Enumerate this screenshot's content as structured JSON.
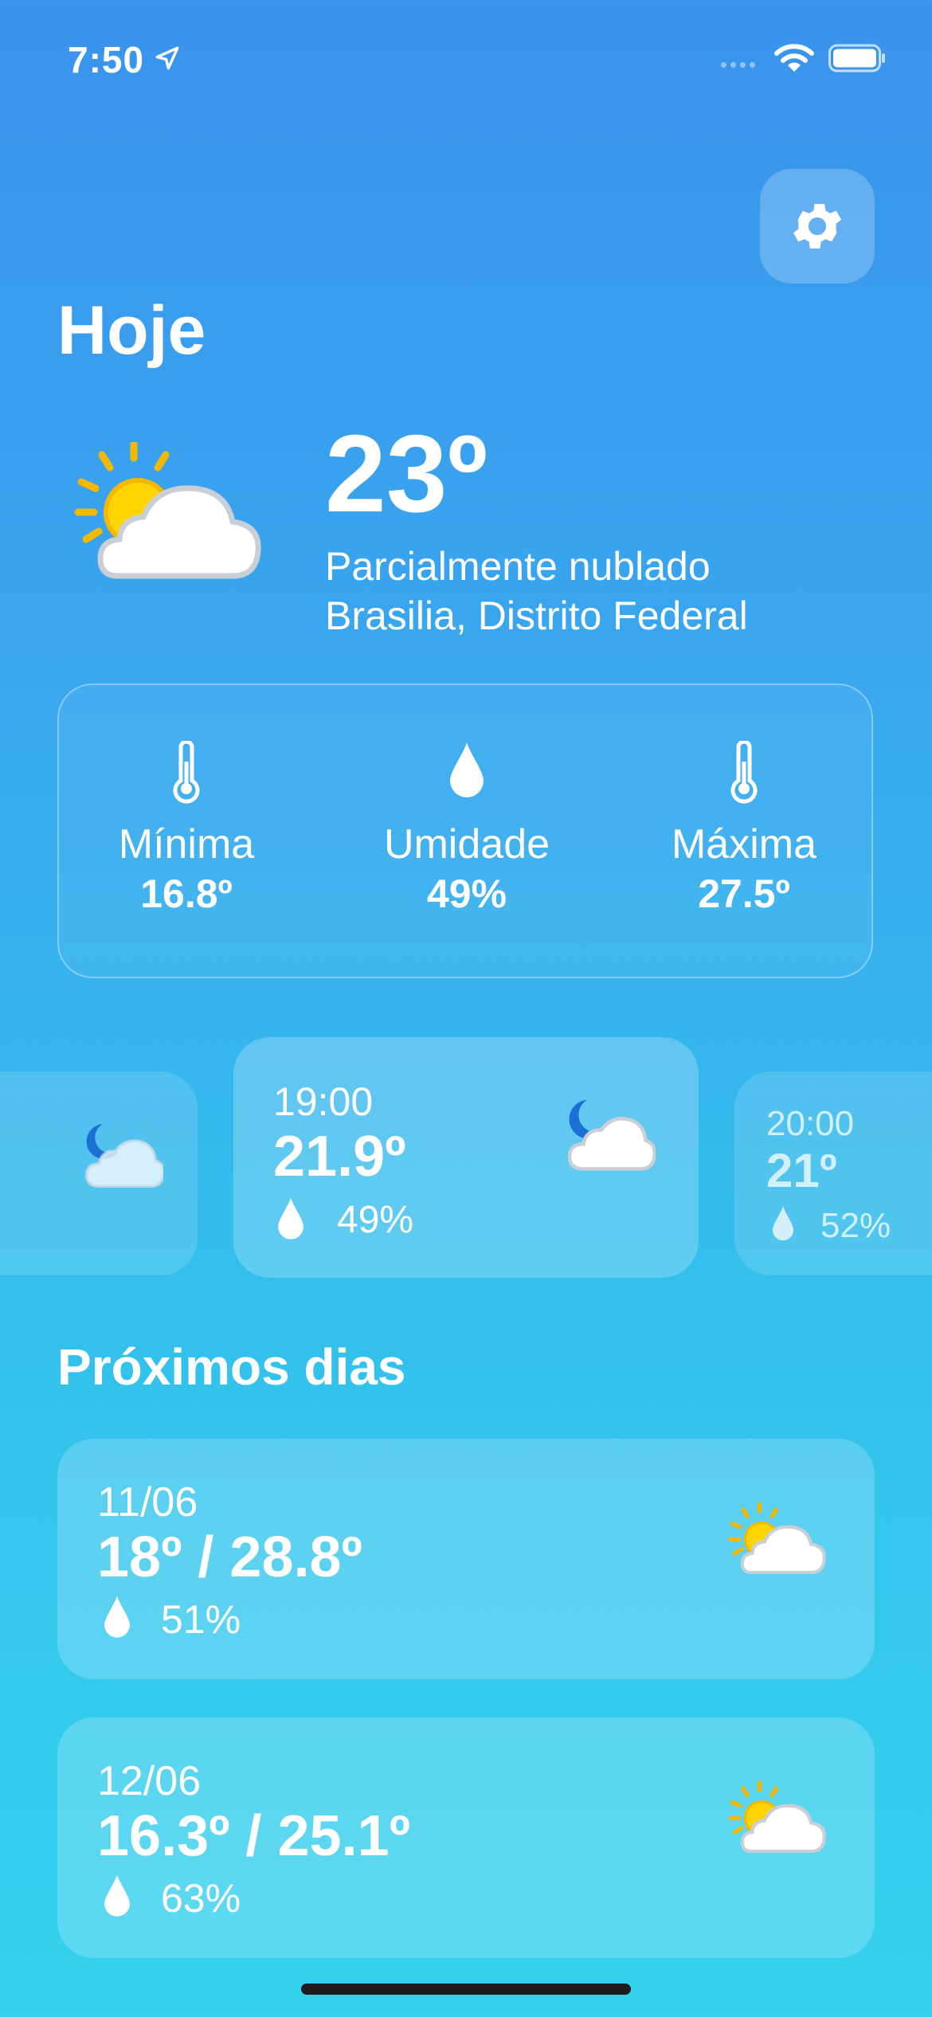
{
  "status_bar": {
    "time": "7:50"
  },
  "header": {
    "title": "Hoje"
  },
  "current": {
    "temperature": "23º",
    "condition": "Parcialmente nublado",
    "location": "Brasilia, Distrito Federal",
    "icon": "partly-cloudy-day-icon"
  },
  "stats": {
    "min": {
      "label": "Mínima",
      "value": "16.8º",
      "icon": "thermometer-icon"
    },
    "humidity": {
      "label": "Umidade",
      "value": "49%",
      "icon": "droplet-icon"
    },
    "max": {
      "label": "Máxima",
      "value": "27.5º",
      "icon": "thermometer-icon"
    }
  },
  "hourly": [
    {
      "time": "",
      "temp": "",
      "humidity": "",
      "icon": "partly-cloudy-night-icon"
    },
    {
      "time": "19:00",
      "temp": "21.9º",
      "humidity": "49%",
      "icon": "partly-cloudy-night-icon"
    },
    {
      "time": "20:00",
      "temp": "21º",
      "humidity": "52%",
      "icon": "partly-cloudy-night-icon"
    }
  ],
  "forecast": {
    "title": "Próximos dias",
    "days": [
      {
        "date": "11/06",
        "range": "18º / 28.8º",
        "humidity": "51%",
        "icon": "partly-cloudy-day-icon"
      },
      {
        "date": "12/06",
        "range": "16.3º / 25.1º",
        "humidity": "63%",
        "icon": "partly-cloudy-day-icon"
      }
    ]
  },
  "colors": {
    "bg_top": "#3a93ec",
    "bg_bottom": "#35d2ee",
    "sun": "#ffd400",
    "sun_rays": "#f5b800",
    "moon": "#1d6fd6"
  }
}
